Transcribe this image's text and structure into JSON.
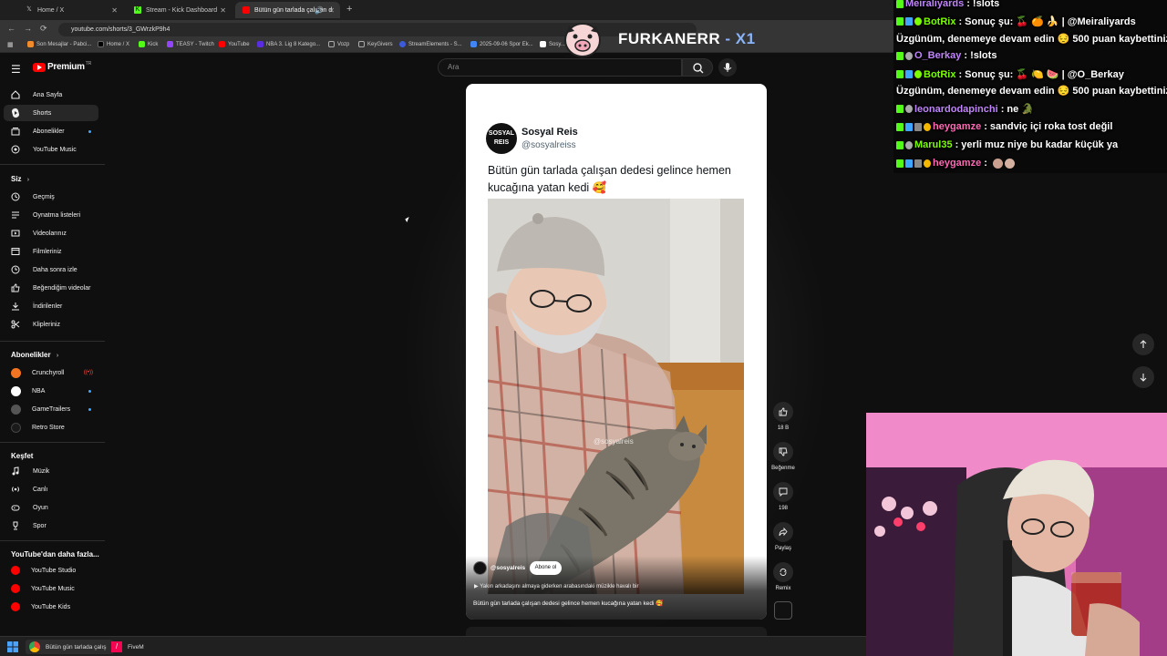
{
  "browser": {
    "tabs": [
      {
        "title": "Home / X",
        "icon": "x-icon"
      },
      {
        "title": "Stream - Kick Dashboard",
        "icon": "kick-icon"
      },
      {
        "title": "Bütün gün tarlada çalışan d",
        "icon": "youtube-icon"
      }
    ],
    "url": "youtube.com/shorts/3_GWrzkP9h4",
    "bookmarks": [
      "Son Mesajlar - Pabci...",
      "Home / X",
      "Kick",
      "TEASY - Twitch",
      "YouTube",
      "NBA 3. Lig 8 Katego...",
      "Vozp",
      "KeyGivers",
      "StreamElements - S...",
      "2025-09-06 Spor Ek...",
      "Sosy..."
    ]
  },
  "overlay": {
    "streamer_name": "FURKANERR",
    "suffix": "- X1"
  },
  "youtube": {
    "logo_word": "Premium",
    "logo_country": "TR",
    "search_placeholder": "Ara",
    "sidebar": {
      "main": [
        {
          "label": "Ana Sayfa",
          "icon": "home-icon"
        },
        {
          "label": "Shorts",
          "icon": "shorts-icon",
          "active": true
        },
        {
          "label": "Abonelikler",
          "icon": "subscriptions-icon",
          "dot": true
        }
      ],
      "you_header": "Siz",
      "you": [
        {
          "label": "YouTube Music",
          "icon": "music-circle-icon"
        }
      ],
      "library": [
        {
          "label": "Geçmiş",
          "icon": "history-icon"
        },
        {
          "label": "Oynatma listeleri",
          "icon": "playlist-icon"
        },
        {
          "label": "Videolarınız",
          "icon": "your-videos-icon"
        },
        {
          "label": "Filmleriniz",
          "icon": "movies-icon"
        },
        {
          "label": "Daha sonra izle",
          "icon": "watch-later-icon"
        },
        {
          "label": "Beğendiğim videolar",
          "icon": "like-icon"
        },
        {
          "label": "İndirilenler",
          "icon": "download-icon"
        },
        {
          "label": "Klipleriniz",
          "icon": "clips-icon"
        }
      ],
      "subs_header": "Abonelikler",
      "subscriptions": [
        {
          "label": "Crunchyroll",
          "color": "#f47521",
          "live": true
        },
        {
          "label": "NBA",
          "color": "#ffffff",
          "dot": true
        },
        {
          "label": "GameTrailers",
          "color": "#555555",
          "dot": true
        },
        {
          "label": "Retro Store",
          "color": "#1a1a1a"
        }
      ],
      "explore_header": "Keşfet",
      "explore": [
        {
          "label": "Müzik",
          "icon": "music-note-icon"
        },
        {
          "label": "Canlı",
          "icon": "live-icon"
        },
        {
          "label": "Oyun",
          "icon": "gaming-icon"
        },
        {
          "label": "Spor",
          "icon": "trophy-icon"
        }
      ],
      "more_header": "YouTube'dan daha fazla...",
      "more": [
        {
          "label": "YouTube Studio"
        },
        {
          "label": "YouTube Music"
        },
        {
          "label": "YouTube Kids"
        }
      ]
    },
    "short": {
      "tweet_name": "Sosyal Reis",
      "tweet_handle": "@sosyalreiss",
      "avatar_text": "SOSYAL REIS",
      "tweet_text": "Bütün gün tarlada çalışan dedesi gelince hemen kucağına yatan kedi 🥰",
      "watermark": "@sosyalreis",
      "channel": "@sosyalreis",
      "subscribe": "Abone ol",
      "music": "Yakın arkadaşını almaya giderken arabasındaki müzikle havalı bir",
      "caption": "Bütün gün tarlada çalışan dedesi gelince hemen kucağına yatan kedi 🥰"
    },
    "actions": [
      {
        "label": "18 B",
        "icon": "thumbs-up-icon"
      },
      {
        "label": "Beğenme",
        "icon": "thumbs-down-icon"
      },
      {
        "label": "198",
        "icon": "comment-icon"
      },
      {
        "label": "Paylaş",
        "icon": "share-icon"
      },
      {
        "label": "Remix",
        "icon": "remix-icon"
      }
    ]
  },
  "chat": [
    {
      "user": "Meiraliyards",
      "color": "#c084fc",
      "text": ": !slots"
    },
    {
      "user": "BotRix",
      "color": "#7CFC00",
      "text": ": Sonuç şu: 🍒 🍊 🍌 | @Meiraliyards"
    },
    {
      "user": "",
      "color": "#ffffff",
      "text": "Üzgünüm, denemeye devam edin 😔 500 puan kaybettiniz."
    },
    {
      "user": "O_Berkay",
      "color": "#c084fc",
      "text": ": !slots"
    },
    {
      "user": "BotRix",
      "color": "#7CFC00",
      "text": ": Sonuç şu: 🍒 🍋 🍉 | @O_Berkay"
    },
    {
      "user": "",
      "color": "#ffffff",
      "text": "Üzgünüm, denemeye devam edin 😔 500 puan kaybettiniz."
    },
    {
      "user": "leonardodapinchi",
      "color": "#c084fc",
      "text": ": ne 🐊"
    },
    {
      "user": "heygamze",
      "color": "#ff69b4",
      "text": ": sandviç içi roka tost değil"
    },
    {
      "user": "Marul35",
      "color": "#7CFC00",
      "text": ": yerli muz niye bu kadar küçük ya"
    },
    {
      "user": "heygamze",
      "color": "#ff69b4",
      "text": ":"
    }
  ],
  "taskbar": [
    {
      "label": "Bütün gün tarlada çalış",
      "icon": "chrome-icon"
    },
    {
      "label": "FiveM",
      "icon": "fivem-icon"
    }
  ],
  "colors": {
    "yt_red": "#ff0000",
    "kick_green": "#53fc18",
    "accent_blue": "#3ea6ff"
  }
}
